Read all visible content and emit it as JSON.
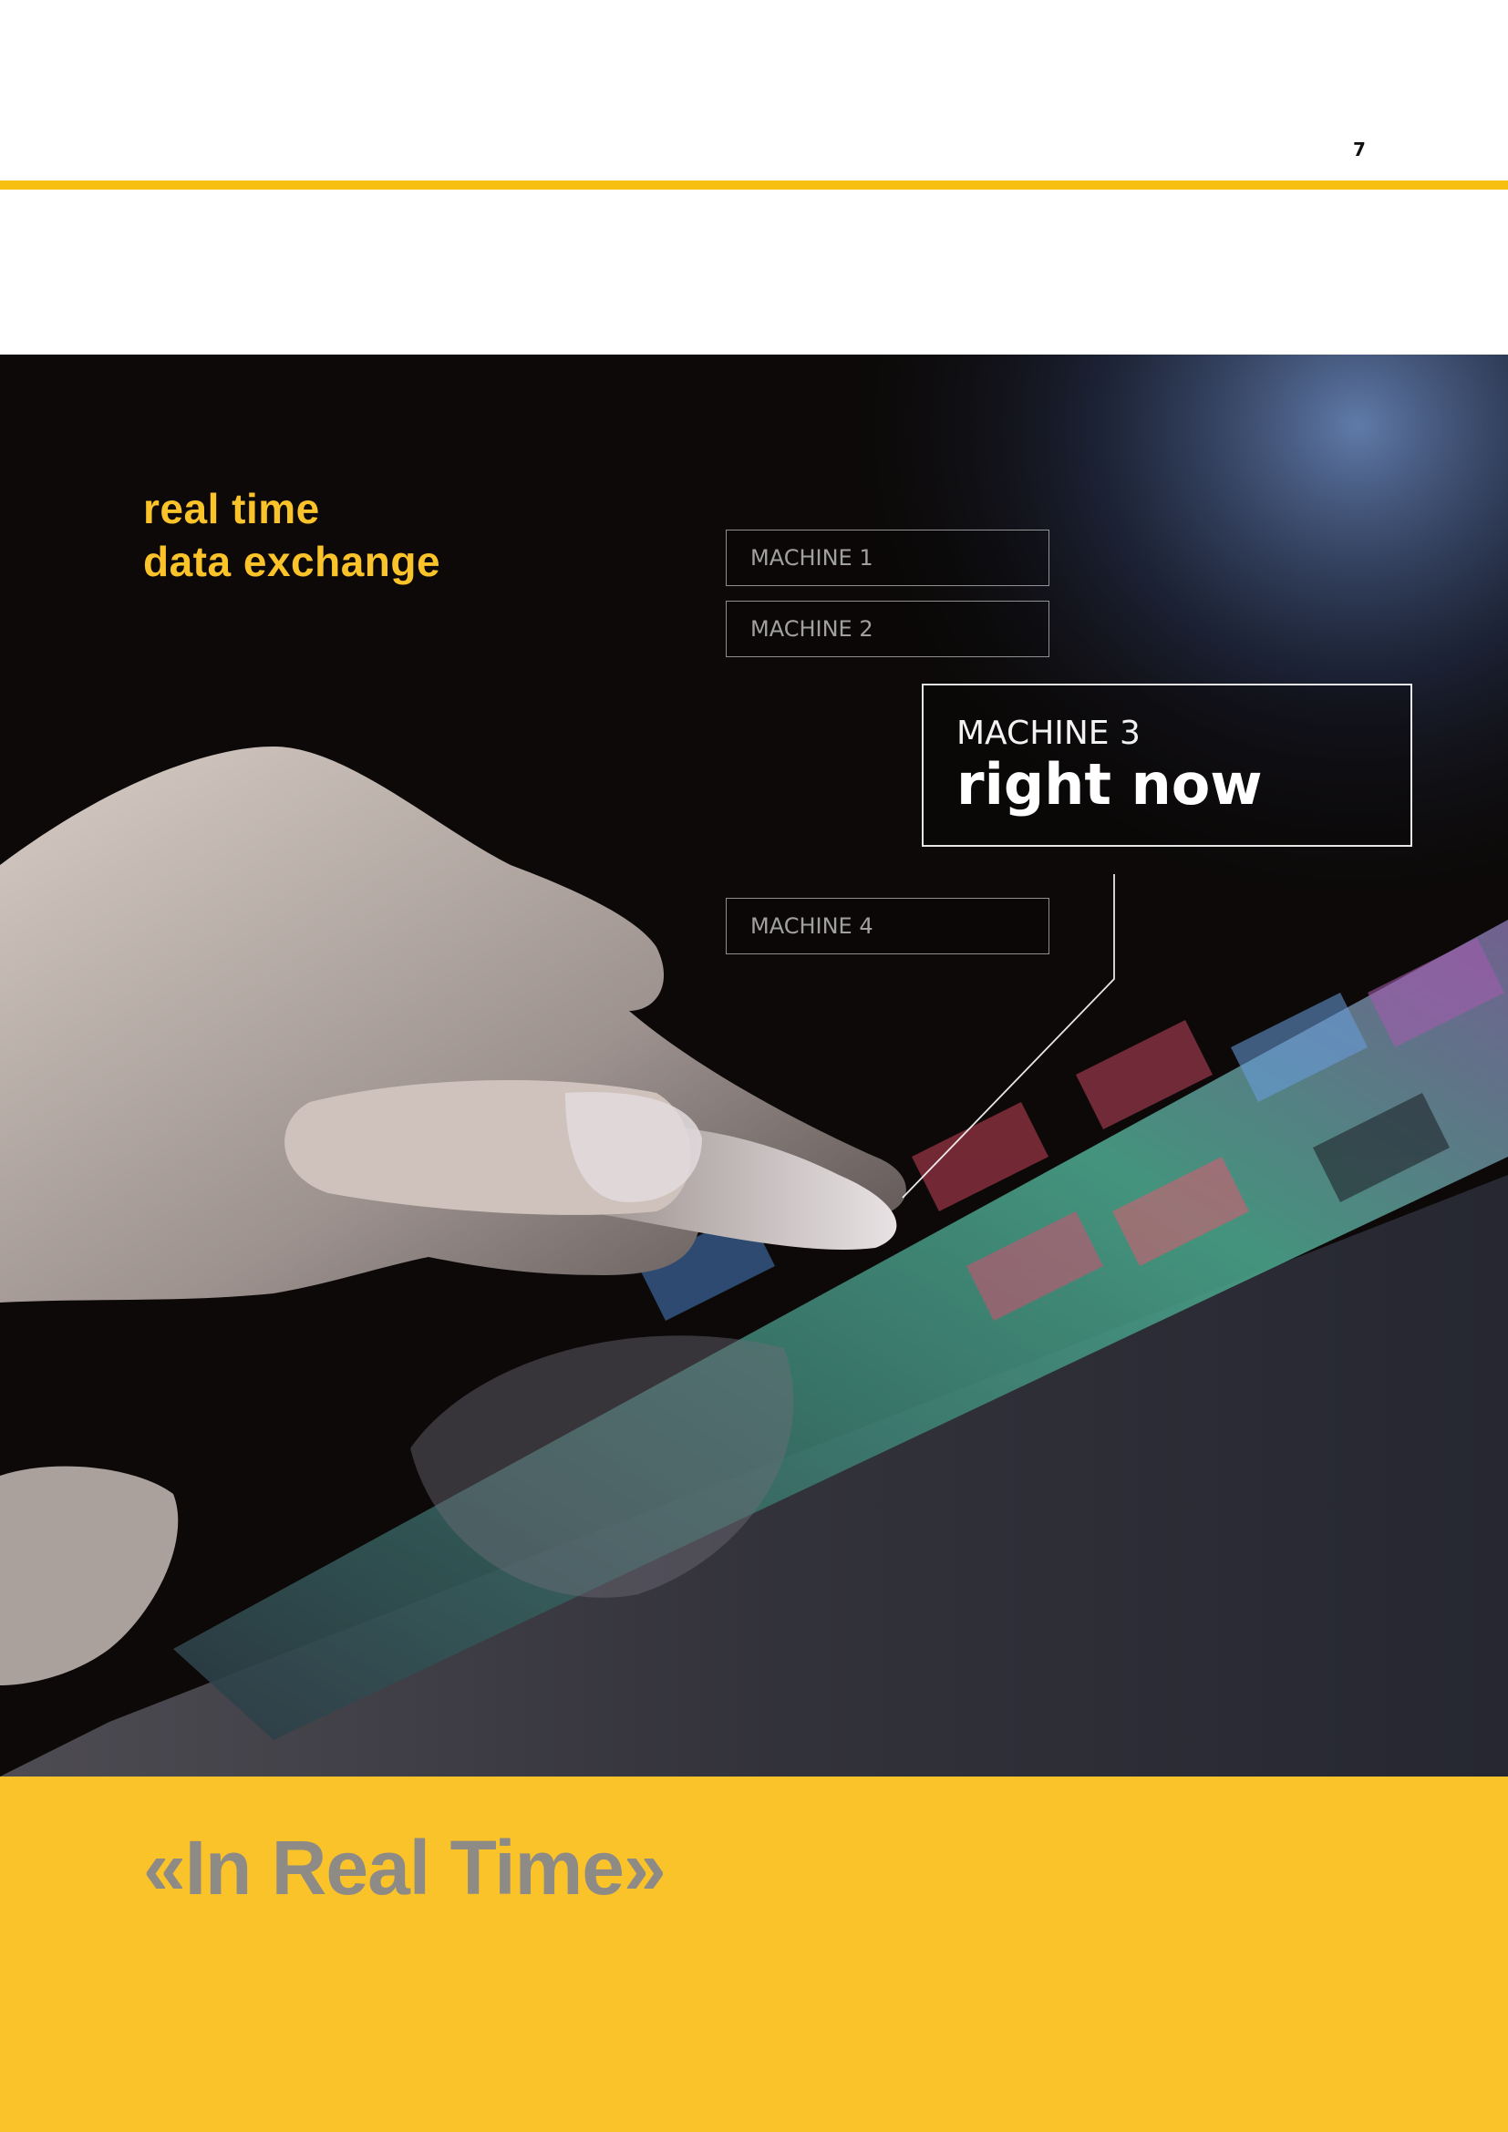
{
  "page": {
    "number": "7"
  },
  "colors": {
    "accent": "#fbc32a",
    "rule": "#f7c010",
    "quote_text": "#8e8a86",
    "photo_dark": "#0c0908"
  },
  "hero": {
    "headline_line1": "real time",
    "headline_line2": "data exchange",
    "machines": [
      {
        "label": "MACHINE 1"
      },
      {
        "label": "MACHINE 2"
      },
      {
        "label": "MACHINE 3",
        "status": "right now",
        "active": true
      },
      {
        "label": "MACHINE 4"
      }
    ]
  },
  "band": {
    "quote": "«In Real Time»"
  }
}
